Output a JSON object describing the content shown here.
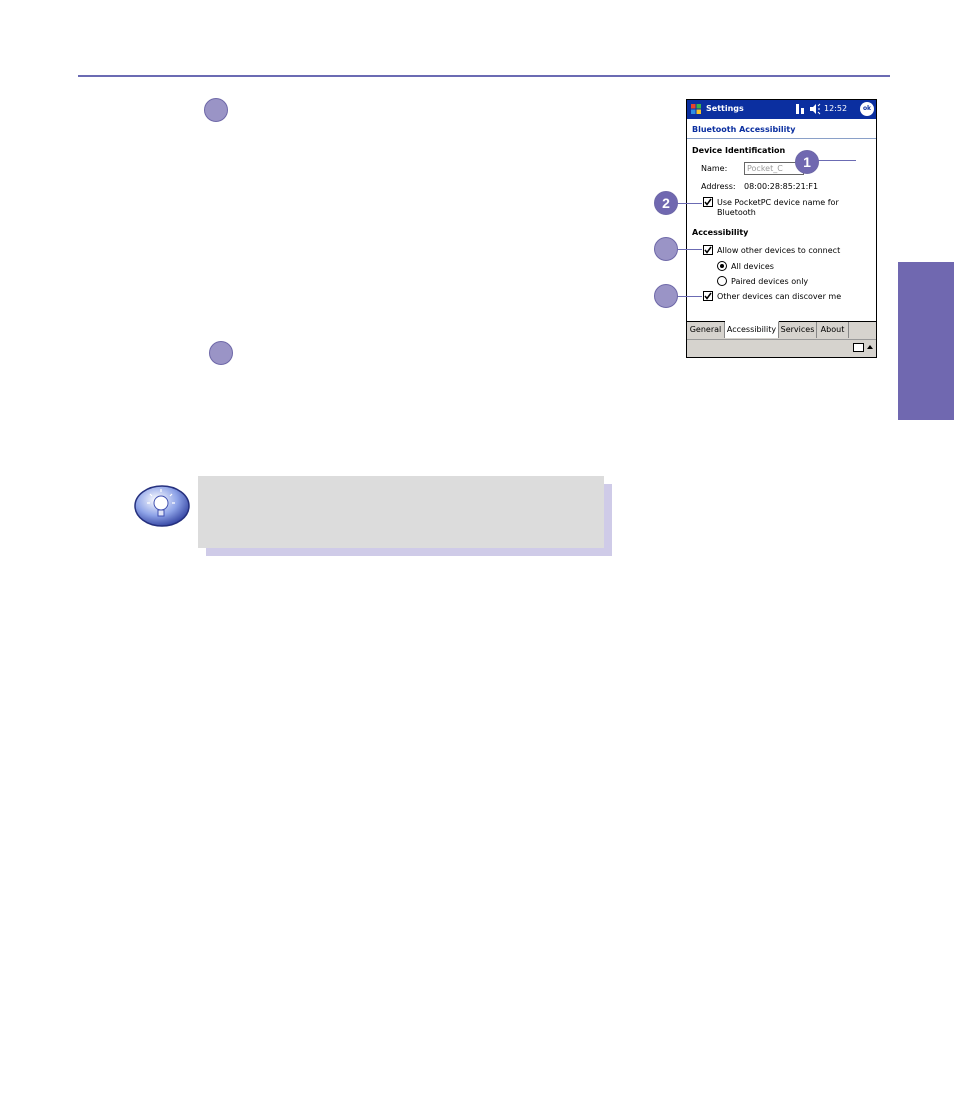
{
  "colors": {
    "rule": "#6b6bb3",
    "side_tab": "#7068b0",
    "bullet": "#9a94c6",
    "note_box": "#dcdcdc",
    "note_shadow": "#cfcbe8",
    "ppc_title_bar": "#0b2fa0"
  },
  "device_screenshot": {
    "title_bar": {
      "app_name": "Settings",
      "time": "12:52",
      "ok_label": "ok",
      "icons": [
        "windows-logo-icon",
        "signal-icon",
        "speaker-icon"
      ]
    },
    "page_title": "Bluetooth Accessibility",
    "device_identification": {
      "heading": "Device Identification",
      "name_label": "Name:",
      "name_value": "Pocket_C",
      "address_label": "Address:",
      "address_value": "08:00:28:85:21:F1",
      "use_ppc_name_label": "Use PocketPC device name for",
      "use_ppc_name_label_line2": "Bluetooth",
      "use_ppc_name_checked": true
    },
    "accessibility": {
      "heading": "Accessibility",
      "allow_connect_label": "Allow other devices to connect",
      "allow_connect_checked": true,
      "radio_all_label": "All devices",
      "radio_all_selected": true,
      "radio_paired_label": "Paired devices only",
      "radio_paired_selected": false,
      "discover_label": "Other devices can discover me",
      "discover_checked": true
    },
    "tabs": [
      "General",
      "Accessibility",
      "Services",
      "About"
    ],
    "active_tab": "Accessibility"
  },
  "callouts": {
    "c1": "1",
    "c2": "2"
  }
}
